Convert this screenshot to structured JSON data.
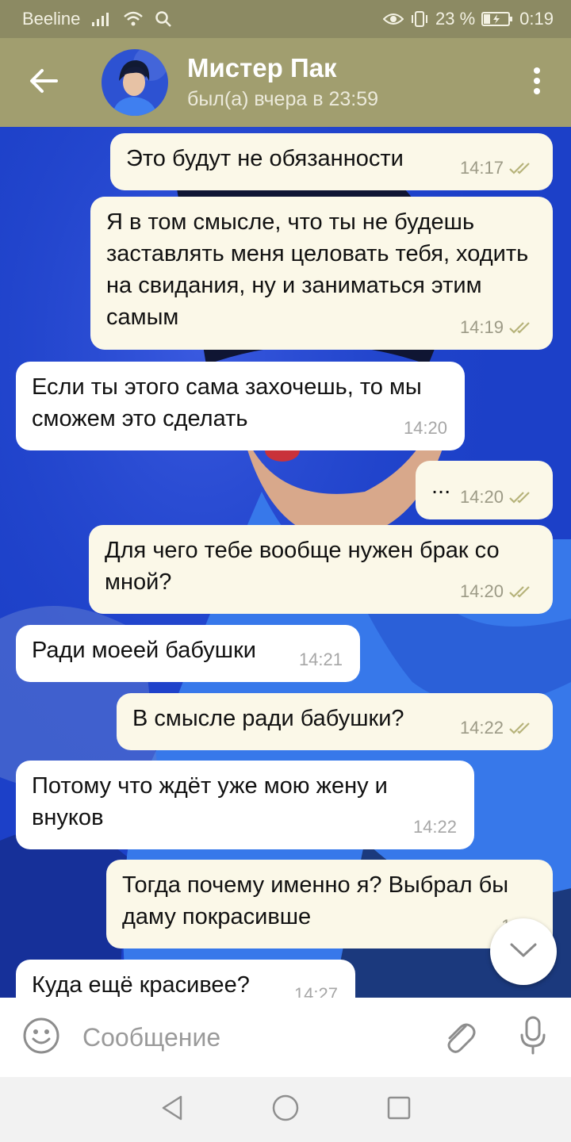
{
  "status_bar": {
    "carrier": "Beeline",
    "battery": "23 %",
    "time": "0:19"
  },
  "header": {
    "name": "Мистер Пак",
    "status": "был(а) вчера в 23:59"
  },
  "messages": [
    {
      "direction": "out",
      "text": "Это будут не обязанности",
      "time": "14:17",
      "read": true
    },
    {
      "direction": "out",
      "text": "Я в том смысле, что ты не будешь заставлять меня целовать тебя, ходить на свидания, ну и заниматься этим самым",
      "time": "14:19",
      "read": true
    },
    {
      "direction": "in",
      "text": "Если ты этого сама захочешь, то мы сможем это сделать",
      "time": "14:20"
    },
    {
      "direction": "out",
      "text": "...",
      "time": "14:20",
      "read": true
    },
    {
      "direction": "out",
      "text": "Для чего тебе вообще нужен брак со мной?",
      "time": "14:20",
      "read": true
    },
    {
      "direction": "in",
      "text": "Ради моеей  бабушки",
      "time": "14:21"
    },
    {
      "direction": "out",
      "text": "В смысле ради бабушки?",
      "time": "14:22",
      "read": true
    },
    {
      "direction": "in",
      "text": "Потому что ждёт уже мою жену и внуков",
      "time": "14:22"
    },
    {
      "direction": "out",
      "text": "Тогда почему именно я? Выбрал бы даму покрасивше",
      "time": "14:2"
    },
    {
      "direction": "in",
      "text": "Куда ещё красивее?",
      "time": "14:27"
    }
  ],
  "input": {
    "placeholder": "Сообщение"
  },
  "colors": {
    "status_bar": "#8c8a63",
    "header": "#a19e6f",
    "outgoing_bubble": "#fbf8e8",
    "incoming_bubble": "#ffffff",
    "read_check": "#b6b37a",
    "wallpaper_blue": "#1d3cc0"
  },
  "icons": {
    "back": "arrow-left-icon",
    "menu": "more-vertical-icon",
    "emoji": "smile-icon",
    "attach": "paperclip-icon",
    "mic": "microphone-icon",
    "scroll": "chevron-down-icon"
  }
}
